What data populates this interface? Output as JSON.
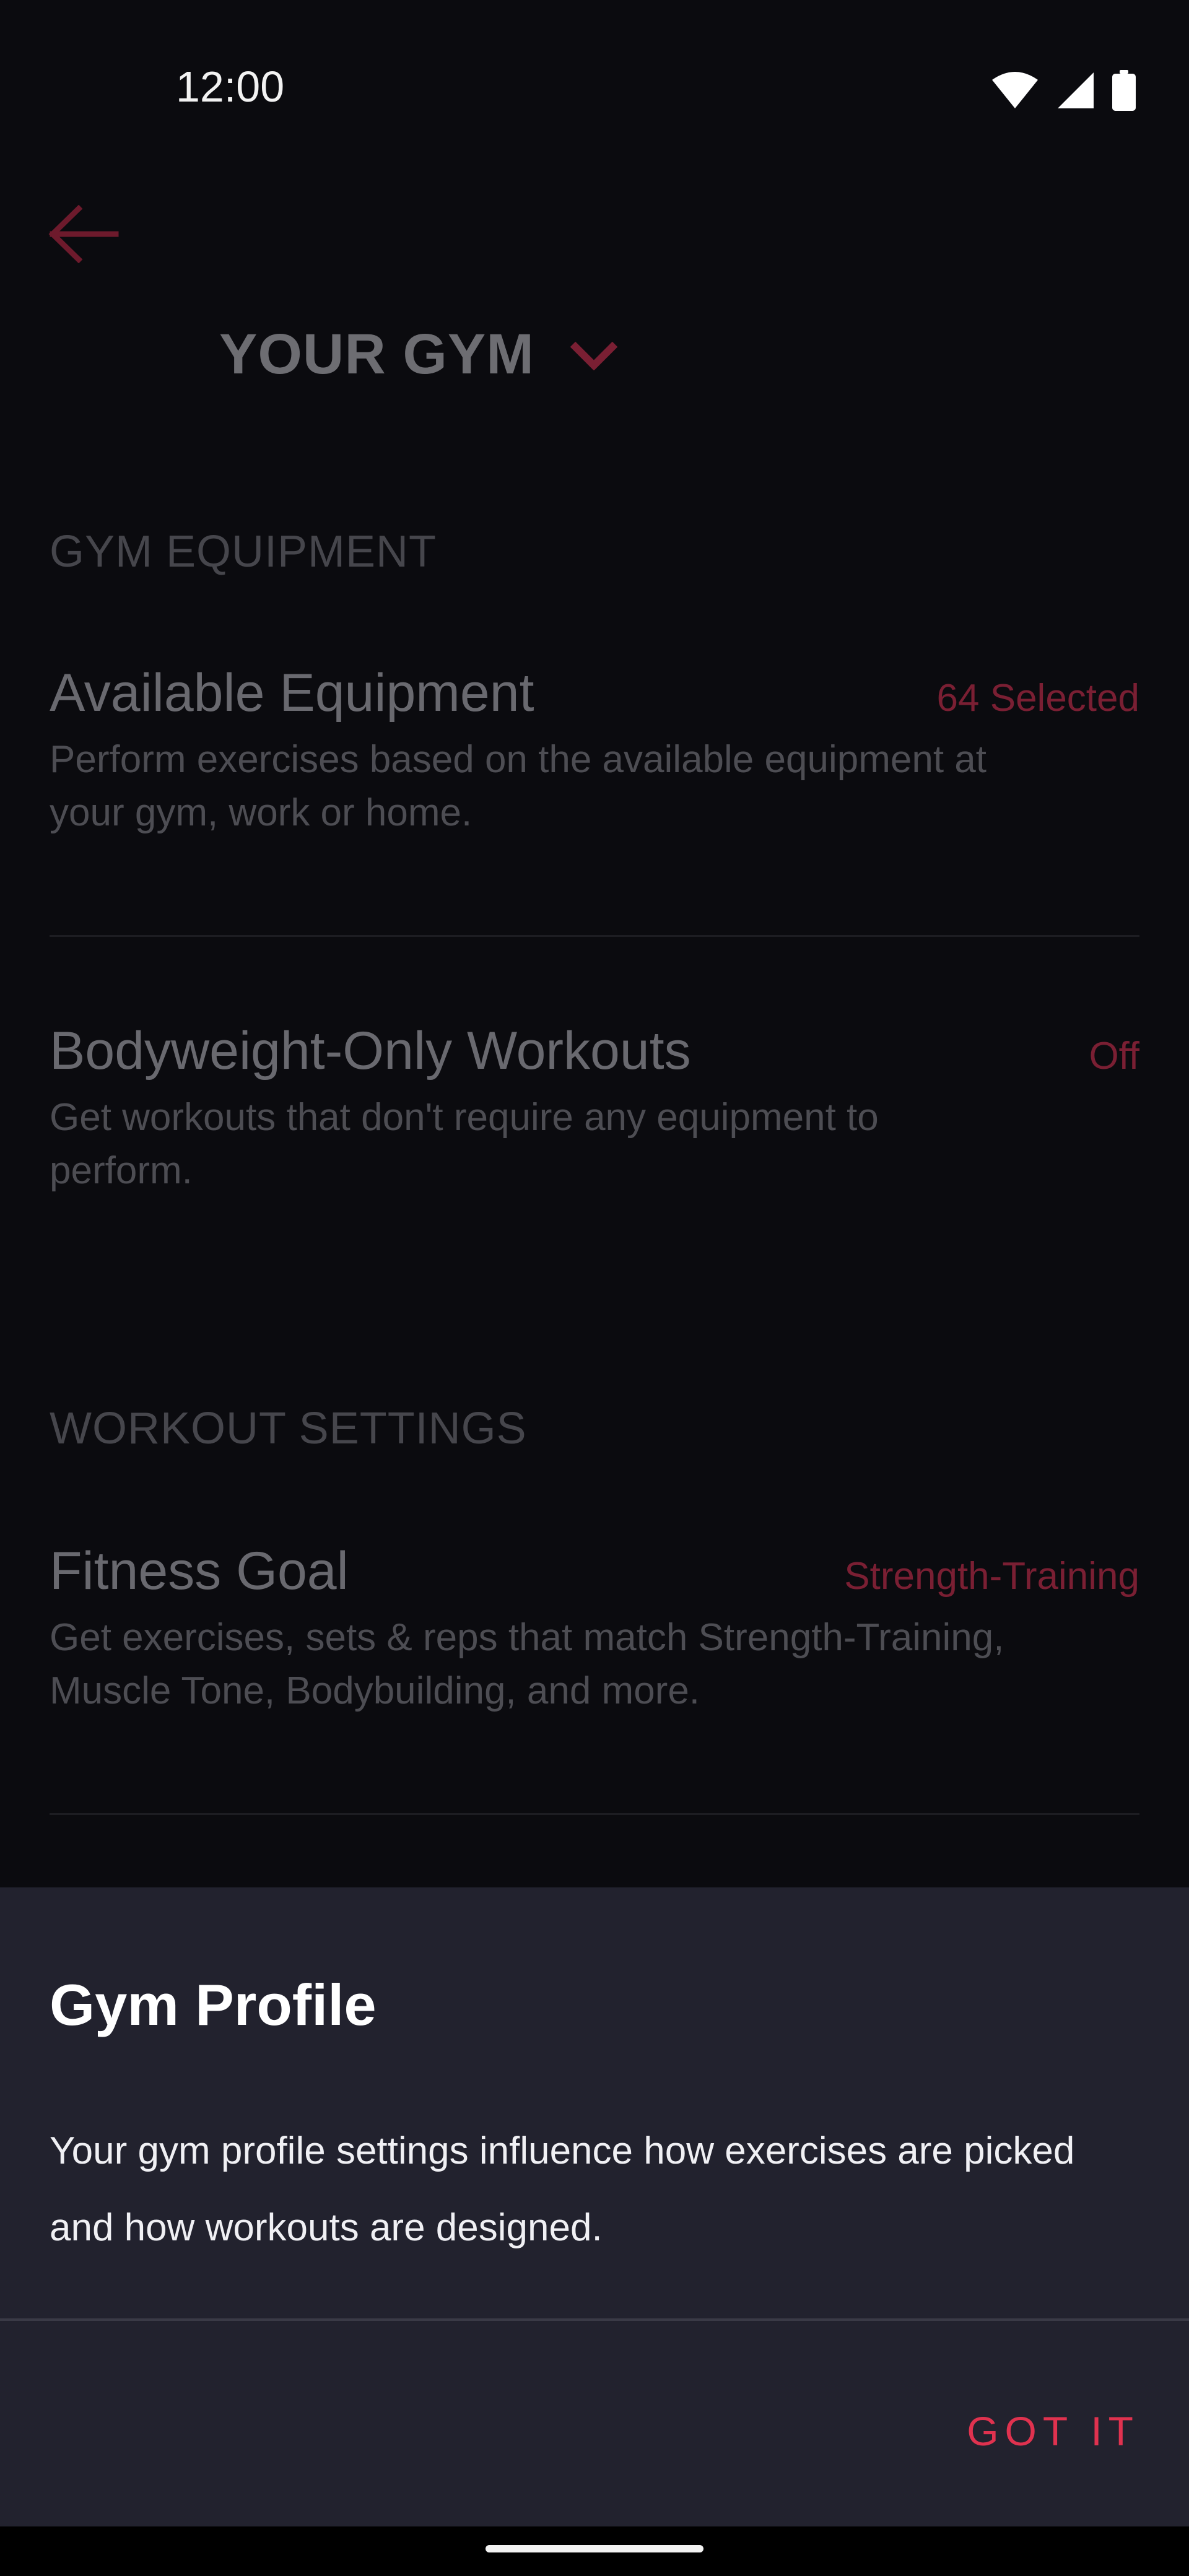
{
  "status_bar": {
    "time": "12:00",
    "icons": [
      "wifi-icon",
      "signal-icon",
      "battery-icon"
    ]
  },
  "header": {
    "back_icon": "arrow-left-icon",
    "title": "YOUR GYM",
    "dropdown_icon": "chevron-down-icon"
  },
  "gym_equipment": {
    "section_title": "GYM EQUIPMENT",
    "items": [
      {
        "title": "Available Equipment",
        "value": "64 Selected",
        "description": "Perform exercises based on the available equipment at your gym, work or home."
      },
      {
        "title": "Bodyweight-Only Workouts",
        "value": "Off",
        "description": "Get workouts that don't require any equipment to perform."
      }
    ]
  },
  "workout_settings": {
    "section_title": "WORKOUT SETTINGS",
    "items": [
      {
        "title": "Fitness Goal",
        "value": "Strength-Training",
        "description": "Get exercises, sets & reps that match Strength-Training, Muscle Tone, Bodybuilding, and more."
      }
    ]
  },
  "dialog": {
    "title": "Gym Profile",
    "message": "Your gym profile settings influence how exercises are picked and how workouts are designed.",
    "button_label": "GOT IT"
  },
  "colors": {
    "accent": "#e0324f",
    "accent_dimmed": "#7a1f33",
    "background": "#0b0b0f",
    "sheet_background": "#22222e"
  }
}
